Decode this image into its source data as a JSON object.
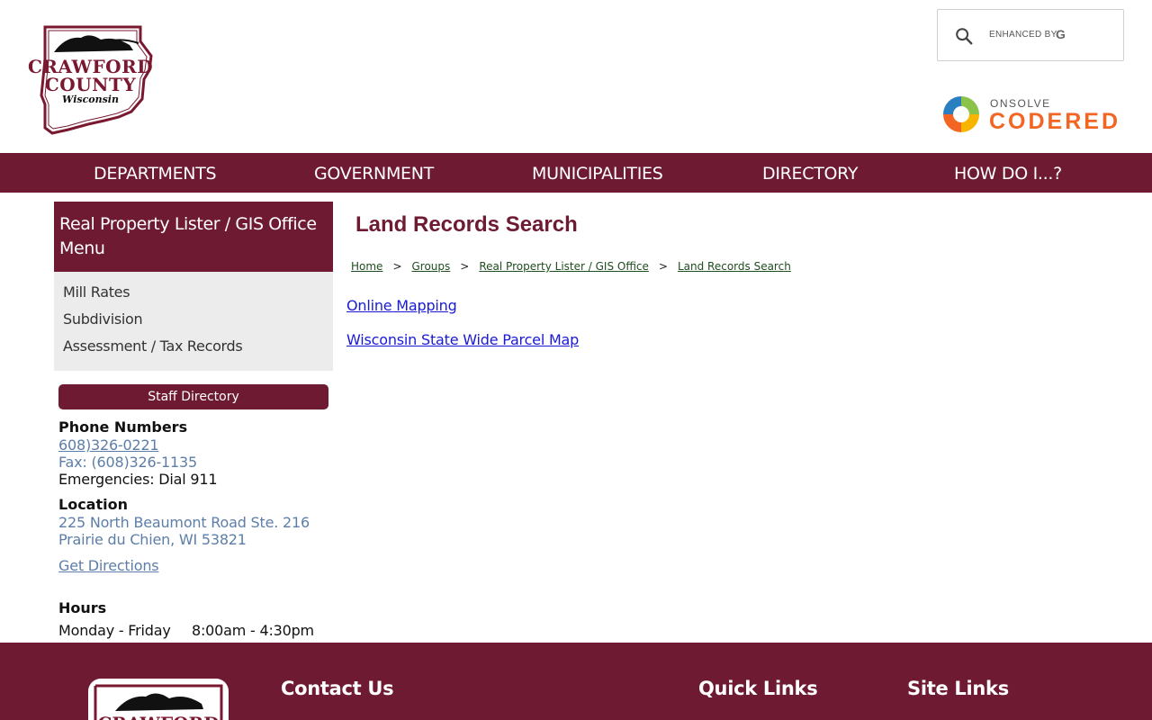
{
  "header": {
    "logo": {
      "line1": "CRAWFORD",
      "line2": "COUNTY",
      "line3": "Wisconsin"
    },
    "search": {
      "placeholder": "",
      "enhanced_label": "ENHANCED BY",
      "google_mark": "G"
    },
    "codered": {
      "brand_small": "ONSOLVE",
      "brand_main": "CODERED"
    }
  },
  "nav": {
    "items": [
      {
        "label": "DEPARTMENTS"
      },
      {
        "label": "GOVERNMENT"
      },
      {
        "label": "MUNICIPALITIES"
      },
      {
        "label": "DIRECTORY"
      },
      {
        "label": "HOW DO I...?"
      }
    ]
  },
  "sidebar": {
    "menu_title": "Real Property Lister / GIS Office Menu",
    "menu_items": [
      {
        "label": "Mill Rates"
      },
      {
        "label": "Subdivision"
      },
      {
        "label": "Assessment / Tax Records"
      }
    ],
    "staff_directory_label": "Staff Directory",
    "phone": {
      "heading": "Phone Numbers",
      "main": "608)326-0221",
      "fax": "Fax: (608)326-1135",
      "emergency": "Emergencies: Dial 911"
    },
    "location": {
      "heading": "Location",
      "address1": "225 North Beaumont Road Ste. 216",
      "address2": "Prairie du Chien, WI 53821",
      "directions_label": "Get Directions"
    },
    "hours": {
      "heading": "Hours",
      "days": "Monday - Friday",
      "times": "8:00am - 4:30pm"
    }
  },
  "main": {
    "title": "Land Records Search",
    "breadcrumb": [
      {
        "label": "Home"
      },
      {
        "label": "Groups"
      },
      {
        "label": "Real Property Lister / GIS Office"
      },
      {
        "label": "Land Records Search"
      }
    ],
    "breadcrumb_separator": ">",
    "links": [
      {
        "label": "Online Mapping "
      },
      {
        "label": "Wisconsin State Wide Parcel Map"
      }
    ]
  },
  "footer": {
    "contact_heading": "Contact Us",
    "quick_links_heading": "Quick Links",
    "site_links_heading": "Site Links",
    "logo_text": "CRAWFORD"
  },
  "colors": {
    "brand_maroon": "#6e1a33",
    "link_blue": "#1a1ad6",
    "codered_orange": "#f26522",
    "sidebar_gray": "#ececec"
  }
}
